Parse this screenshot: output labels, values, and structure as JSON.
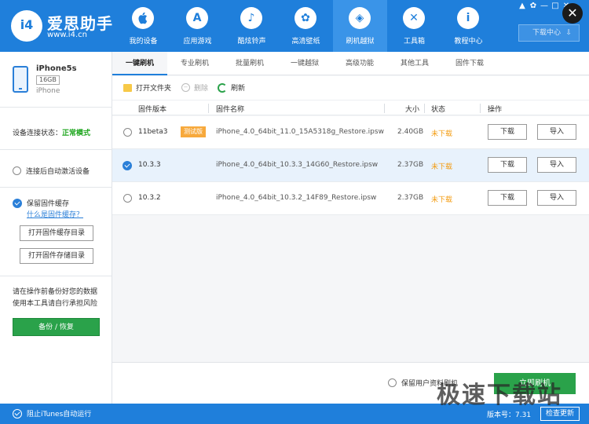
{
  "app": {
    "brand_name": "爱思助手",
    "brand_url": "www.i4.cn",
    "logo_mark": "i4"
  },
  "nav": {
    "items": [
      {
        "label": "我的设备",
        "icon": "apple-icon",
        "glyph": ""
      },
      {
        "label": "应用游戏",
        "icon": "app-store-icon",
        "glyph": "A"
      },
      {
        "label": "酷炫铃声",
        "icon": "bell-icon",
        "glyph": "♪"
      },
      {
        "label": "高清壁纸",
        "icon": "flower-icon",
        "glyph": "✿"
      },
      {
        "label": "刷机越狱",
        "icon": "dropbox-icon",
        "glyph": "◈"
      },
      {
        "label": "工具箱",
        "icon": "tools-icon",
        "glyph": "✕"
      },
      {
        "label": "教程中心",
        "icon": "info-icon",
        "glyph": "i"
      }
    ],
    "active_index": 4
  },
  "window": {
    "controls": [
      "▲",
      "✿",
      "—",
      "□",
      "✕"
    ],
    "close_glyph": "✕",
    "download_center_label": "下载中心",
    "download_arrow": "⇩"
  },
  "sidebar": {
    "device_name": "iPhone5s",
    "device_capacity": "16GB",
    "device_model": "iPhone",
    "conn_label": "设备连接状态：",
    "conn_status": "正常模式",
    "auto_activate_label": "连接后自动激活设备",
    "keep_cache_label": "保留固件缓存",
    "what_is_cache": "什么是固件缓存？",
    "open_cache_dir": "打开固件缓存目录",
    "open_storage_dir": "打开固件存储目录",
    "warn_line1": "请在操作前备份好您的数据",
    "warn_line2": "使用本工具请自行承担风险",
    "backup_restore": "备份 / 恢复"
  },
  "tabs": [
    {
      "label": "一键刷机",
      "active": true
    },
    {
      "label": "专业刷机",
      "active": false
    },
    {
      "label": "批量刷机",
      "active": false
    },
    {
      "label": "一键越狱",
      "active": false
    },
    {
      "label": "高级功能",
      "active": false
    },
    {
      "label": "其他工具",
      "active": false
    },
    {
      "label": "固件下载",
      "active": false
    }
  ],
  "toolbar": {
    "open_folder": "打开文件夹",
    "delete": "删除",
    "refresh": "刷新"
  },
  "table": {
    "headers": {
      "version": "固件版本",
      "name": "固件名称",
      "size": "大小",
      "status": "状态",
      "action": "操作"
    },
    "rows": [
      {
        "version": "11beta3",
        "badge": "测试版",
        "name": "iPhone_4.0_64bit_11.0_15A5318g_Restore.ipsw",
        "size": "2.40GB",
        "status": "未下载",
        "download": "下载",
        "import": "导入",
        "selected": false
      },
      {
        "version": "10.3.3",
        "badge": "",
        "name": "iPhone_4.0_64bit_10.3.3_14G60_Restore.ipsw",
        "size": "2.37GB",
        "status": "未下载",
        "download": "下载",
        "import": "导入",
        "selected": true
      },
      {
        "version": "10.3.2",
        "badge": "",
        "name": "iPhone_4.0_64bit_10.3.2_14F89_Restore.ipsw",
        "size": "2.37GB",
        "status": "未下载",
        "download": "下载",
        "import": "导入",
        "selected": false
      }
    ]
  },
  "footer": {
    "keep_user_data": "保留用户资料刷机",
    "flash_now": "立即刷机"
  },
  "statusbar": {
    "block_itunes": "阻止iTunes自动运行",
    "version": "版本号：7.31",
    "check_update": "检查更新"
  },
  "watermark": "极速下载站",
  "colors": {
    "brand_blue": "#1f7fdb",
    "green": "#2aa24a",
    "status_orange": "#f39c12"
  }
}
